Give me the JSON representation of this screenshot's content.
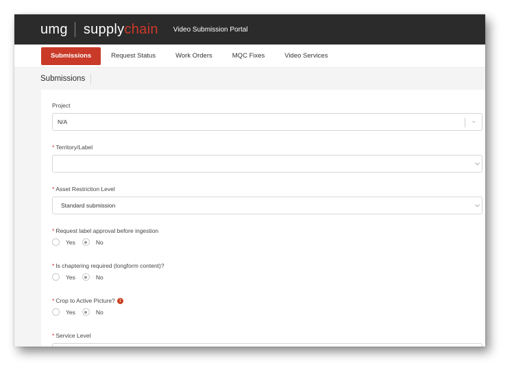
{
  "header": {
    "logo_left": "umg",
    "logo_supply": "supply",
    "logo_chain": "chain",
    "portal_title": "Video Submission Portal"
  },
  "nav": {
    "tabs": [
      {
        "label": "Submissions",
        "active": true
      },
      {
        "label": "Request Status",
        "active": false
      },
      {
        "label": "Work Orders",
        "active": false
      },
      {
        "label": "MQC Fixes",
        "active": false
      },
      {
        "label": "Video Services",
        "active": false
      }
    ]
  },
  "page": {
    "title": "Submissions"
  },
  "form": {
    "project": {
      "label": "Project",
      "value": "N/A"
    },
    "territory": {
      "required_mark": "*",
      "label": "Territory/Label",
      "value": ""
    },
    "asset_restriction": {
      "required_mark": "*",
      "label": "Asset Restriction Level",
      "value": "Standard submission"
    },
    "label_approval": {
      "required_mark": "*",
      "label": "Request label approval before ingestion",
      "yes": "Yes",
      "no": "No",
      "selected": "No"
    },
    "chaptering": {
      "required_mark": "*",
      "label": "Is chaptering required (longform content)?",
      "yes": "Yes",
      "no": "No",
      "selected": "No"
    },
    "crop": {
      "required_mark": "*",
      "label": "Crop to Active Picture?",
      "info_glyph": "!",
      "yes": "Yes",
      "no": "No",
      "selected": "No"
    },
    "service_level": {
      "required_mark": "*",
      "label": "Service Level"
    }
  },
  "colors": {
    "header_bg": "#2b2b2b",
    "accent": "#c93a28",
    "required": "#cf2e2e"
  }
}
